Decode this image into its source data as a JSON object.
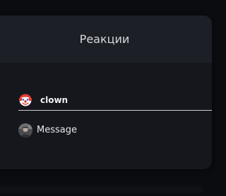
{
  "modal": {
    "title": "Реакции"
  },
  "reaction": {
    "icon": "clown-face-icon",
    "name": "clown"
  },
  "entry": {
    "avatar_icon": "user-avatar",
    "text": "Message"
  },
  "colors": {
    "background": "#0b0c0f",
    "modal_body": "#15171d",
    "modal_header": "#1d1f27",
    "underline": "#c9cacf"
  }
}
